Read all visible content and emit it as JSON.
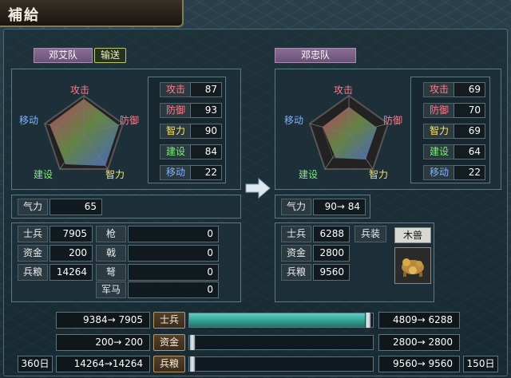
{
  "window": {
    "title": "補給"
  },
  "left_team": {
    "name": "邓艾队",
    "send_label": "输送",
    "pentagon": {
      "attack": "攻击",
      "defense": "防御",
      "move": "移动",
      "build": "建设",
      "intel": "智力"
    },
    "stats": [
      {
        "label": "攻击",
        "value": "87",
        "color": "#ff7a8c"
      },
      {
        "label": "防御",
        "value": "93",
        "color": "#ff7a8c"
      },
      {
        "label": "智力",
        "value": "90",
        "color": "#f6e66a"
      },
      {
        "label": "建设",
        "value": "84",
        "color": "#7fea7a"
      },
      {
        "label": "移动",
        "value": "22",
        "color": "#7fb2ff"
      }
    ],
    "qili": {
      "label": "气力",
      "value": "65"
    },
    "resources": [
      {
        "label": "士兵",
        "value": "7905"
      },
      {
        "label": "资金",
        "value": "200"
      },
      {
        "label": "兵粮",
        "value": "14264"
      }
    ],
    "weapons": [
      {
        "label": "枪",
        "value": "0"
      },
      {
        "label": "戟",
        "value": "0"
      },
      {
        "label": "弩",
        "value": "0"
      },
      {
        "label": "军马",
        "value": "0"
      }
    ]
  },
  "right_team": {
    "name": "邓忠队",
    "pentagon": {
      "attack": "攻击",
      "defense": "防御",
      "move": "移动",
      "build": "建设",
      "intel": "智力"
    },
    "stats": [
      {
        "label": "攻击",
        "value": "69",
        "color": "#ff7a8c"
      },
      {
        "label": "防御",
        "value": "70",
        "color": "#ff7a8c"
      },
      {
        "label": "智力",
        "value": "69",
        "color": "#f6e66a"
      },
      {
        "label": "建设",
        "value": "64",
        "color": "#7fea7a"
      },
      {
        "label": "移动",
        "value": "22",
        "color": "#7fb2ff"
      }
    ],
    "qili": {
      "label": "气力",
      "value": "90→ 84"
    },
    "resources": [
      {
        "label": "士兵",
        "value": "6288"
      },
      {
        "label": "资金",
        "value": "2800"
      },
      {
        "label": "兵粮",
        "value": "9560"
      }
    ],
    "equip": {
      "label": "兵装",
      "item": "木兽",
      "icon": "wooden-beast-icon"
    }
  },
  "transfer": [
    {
      "left": "9384→ 7905",
      "label": "士兵",
      "right": "4809→ 6288",
      "fill_fraction": 0.99
    },
    {
      "left": "200→ 200",
      "label": "资金",
      "right": "2800→ 2800",
      "fill_fraction": 0.0
    },
    {
      "left": "14264→14264",
      "label": "兵粮",
      "right": "9560→ 9560",
      "fill_fraction": 0.0
    }
  ],
  "days": {
    "left": "360日",
    "right": "150日"
  }
}
